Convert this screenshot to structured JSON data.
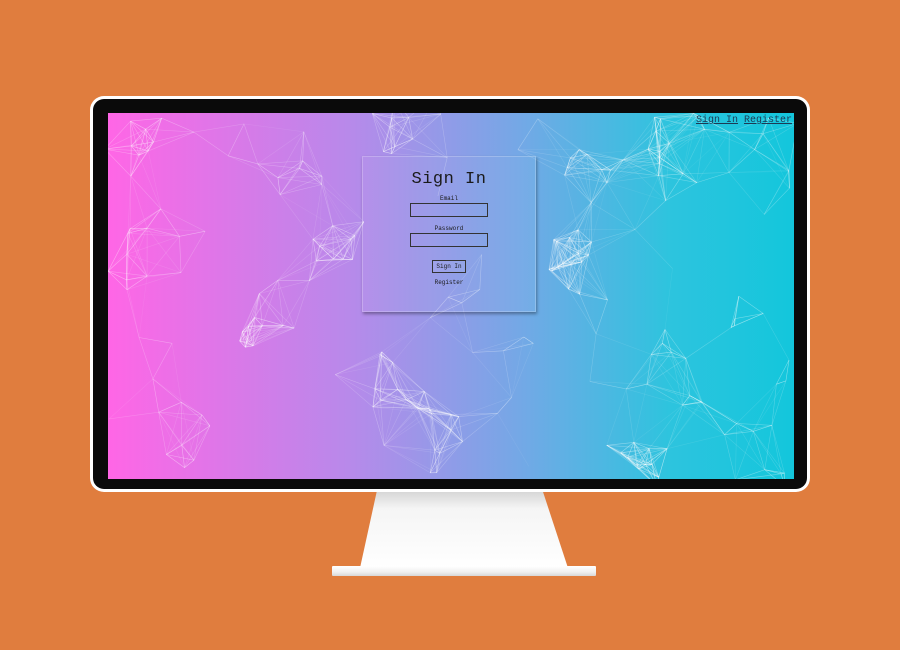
{
  "colors": {
    "background": "#e07d3e",
    "gradient_left": "#ff66e6",
    "gradient_right": "#13c6dc"
  },
  "nav": {
    "sign_in": "Sign In",
    "register": "Register"
  },
  "login": {
    "title": "Sign In",
    "email_label": "Email",
    "email_value": "",
    "password_label": "Password",
    "password_value": "",
    "submit_label": "Sign In",
    "register_label": "Register"
  }
}
